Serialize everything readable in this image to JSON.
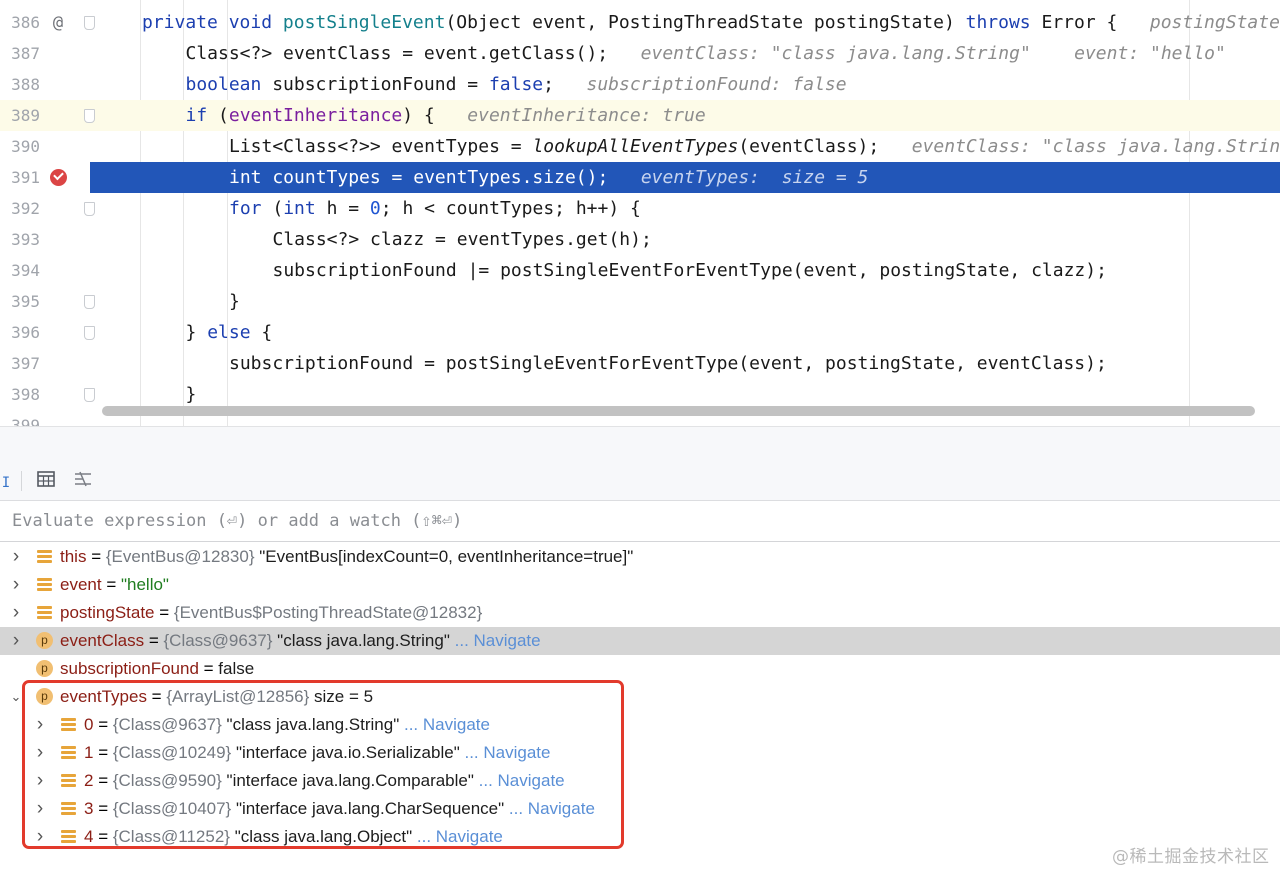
{
  "editor": {
    "lines": [
      {
        "n": "386",
        "icon": "at",
        "fold": true,
        "indent": 0,
        "tokens": [
          [
            "private void ",
            "k"
          ],
          [
            "postSingleEvent",
            "fn"
          ],
          [
            "(Object event, PostingThreadState postingState) ",
            ""
          ],
          [
            "throws",
            "k"
          ],
          [
            " Error {",
            ""
          ]
        ],
        "inline": "postingState"
      },
      {
        "n": "387",
        "indent": 1,
        "tokens": [
          [
            "Class<?> eventClass = event.getClass();",
            ""
          ]
        ],
        "inline": "eventClass: \"class java.lang.String\"    event: \"hello\""
      },
      {
        "n": "388",
        "indent": 1,
        "tokens": [
          [
            "boolean ",
            "k"
          ],
          [
            "subscriptionFound = ",
            ""
          ],
          [
            "false",
            "k"
          ],
          [
            ";",
            ""
          ]
        ],
        "inline": "subscriptionFound: false"
      },
      {
        "n": "389",
        "fold": true,
        "highlight": true,
        "indent": 1,
        "tokens": [
          [
            "if ",
            "k"
          ],
          [
            "(",
            ""
          ],
          [
            "eventInheritance",
            "fld"
          ],
          [
            ") {",
            ""
          ]
        ],
        "inline": "eventInheritance: true"
      },
      {
        "n": "390",
        "indent": 2,
        "tokens": [
          [
            "List<Class<?>> eventTypes = ",
            ""
          ],
          [
            "lookupAllEventTypes",
            "it"
          ],
          [
            "(eventClass);",
            ""
          ]
        ],
        "inline": "eventClass: \"class java.lang.Strin"
      },
      {
        "n": "391",
        "breakpoint": true,
        "exec": true,
        "indent": 2,
        "tokens": [
          [
            "int countTypes = eventTypes.size();",
            ""
          ]
        ],
        "inline": "eventTypes:  size = 5"
      },
      {
        "n": "392",
        "fold": true,
        "indent": 2,
        "tokens": [
          [
            "for ",
            "k"
          ],
          [
            "(",
            ""
          ],
          [
            "int ",
            "k"
          ],
          [
            "h = ",
            ""
          ],
          [
            "0",
            "num"
          ],
          [
            "; h < countTypes; h++) {",
            ""
          ]
        ],
        "inline": ""
      },
      {
        "n": "393",
        "indent": 3,
        "tokens": [
          [
            "Class<?> clazz = eventTypes.get(h);",
            ""
          ]
        ],
        "inline": ""
      },
      {
        "n": "394",
        "indent": 3,
        "tokens": [
          [
            "subscriptionFound |= postSingleEventForEventType(event, postingState, clazz);",
            ""
          ]
        ],
        "inline": ""
      },
      {
        "n": "395",
        "fold": true,
        "indent": 2,
        "tokens": [
          [
            "}",
            ""
          ]
        ],
        "inline": ""
      },
      {
        "n": "396",
        "fold": true,
        "indent": 1,
        "tokens": [
          [
            "} ",
            ""
          ],
          [
            "else",
            "k"
          ],
          [
            " {",
            ""
          ]
        ],
        "inline": ""
      },
      {
        "n": "397",
        "indent": 2,
        "tokens": [
          [
            "subscriptionFound = postSingleEventForEventType(event, postingState, eventClass);",
            ""
          ]
        ],
        "inline": ""
      },
      {
        "n": "398",
        "fold": true,
        "indent": 1,
        "tokens": [
          [
            "}",
            ""
          ]
        ],
        "inline": ""
      },
      {
        "n": "399",
        "indent": 0,
        "tokens": [],
        "inline": ""
      }
    ]
  },
  "toolbar": {
    "icons": [
      "text-cursor-icon",
      "table-view-icon",
      "layout-settings-icon"
    ]
  },
  "evaluate": {
    "placeholder": "Evaluate expression (⏎) or add a watch (⇧⌘⏎)"
  },
  "variables": [
    {
      "chev": "collapsed",
      "icon": "field",
      "name": "this",
      "ref": "{EventBus@12830}",
      "value": "\"EventBus[indexCount=0, eventInheritance=true]\"",
      "valueType": "plain",
      "nav": ""
    },
    {
      "chev": "collapsed",
      "icon": "field",
      "name": "event",
      "ref": "",
      "value": "\"hello\"",
      "valueType": "string",
      "nav": ""
    },
    {
      "chev": "collapsed",
      "icon": "field",
      "name": "postingState",
      "ref": "{EventBus$PostingThreadState@12832}",
      "value": "",
      "valueType": "plain",
      "nav": ""
    },
    {
      "chev": "collapsed",
      "icon": "param",
      "name": "eventClass",
      "ref": "{Class@9637}",
      "value": "\"class java.lang.String\"",
      "valueType": "plain",
      "nav": "... Navigate",
      "selected": true
    },
    {
      "chev": "none",
      "icon": "param",
      "name": "subscriptionFound",
      "ref": "",
      "value": "false",
      "valueType": "plain",
      "nav": ""
    },
    {
      "chev": "expanded",
      "icon": "param",
      "name": "eventTypes",
      "ref": "{ArrayList@12856}",
      "value": " size = 5",
      "valueType": "plain",
      "nav": ""
    },
    {
      "chev": "collapsed",
      "icon": "field",
      "child": true,
      "name": "0",
      "ref": "{Class@9637}",
      "value": "\"class java.lang.String\"",
      "valueType": "plain",
      "nav": "... Navigate"
    },
    {
      "chev": "collapsed",
      "icon": "field",
      "child": true,
      "name": "1",
      "ref": "{Class@10249}",
      "value": "\"interface java.io.Serializable\"",
      "valueType": "plain",
      "nav": "... Navigate"
    },
    {
      "chev": "collapsed",
      "icon": "field",
      "child": true,
      "name": "2",
      "ref": "{Class@9590}",
      "value": "\"interface java.lang.Comparable\"",
      "valueType": "plain",
      "nav": "... Navigate"
    },
    {
      "chev": "collapsed",
      "icon": "field",
      "child": true,
      "name": "3",
      "ref": "{Class@10407}",
      "value": "\"interface java.lang.CharSequence\"",
      "valueType": "plain",
      "nav": "... Navigate"
    },
    {
      "chev": "collapsed",
      "icon": "field",
      "child": true,
      "name": "4",
      "ref": "{Class@11252}",
      "value": "\"class java.lang.Object\"",
      "valueType": "plain",
      "nav": "... Navigate"
    }
  ],
  "watermark": "@稀土掘金技术社区",
  "colors": {
    "execution_line": "#2256b8",
    "annotation_box": "#e23a2c",
    "variable_name": "#8b1e15",
    "navigate_link": "#5a8fd6"
  }
}
